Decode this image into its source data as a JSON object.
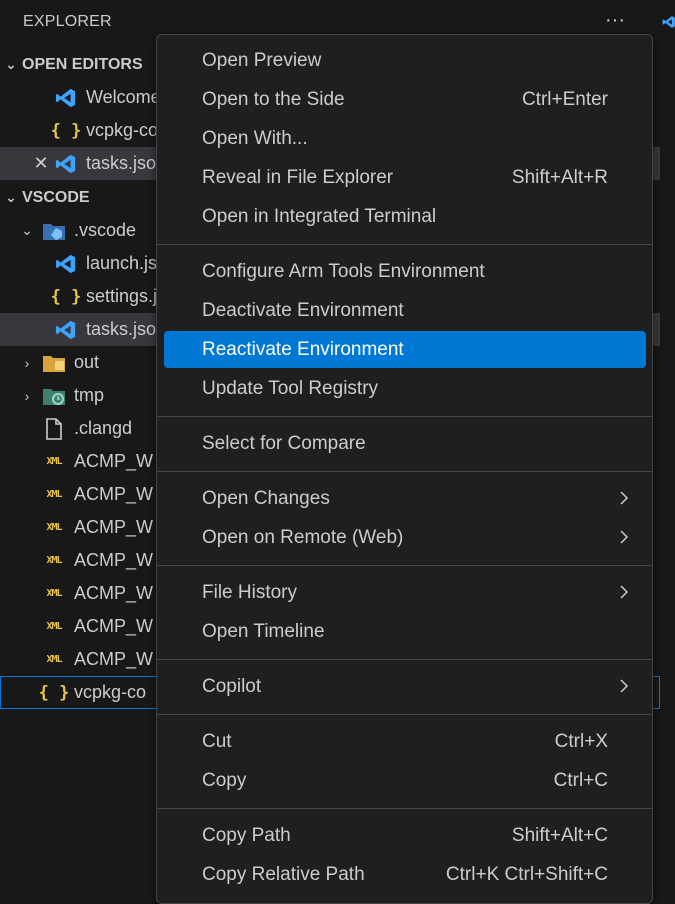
{
  "explorer": {
    "title": "EXPLORER",
    "more_label": "···"
  },
  "open_editors": {
    "header": "OPEN EDITORS",
    "items": [
      {
        "label": "Welcome",
        "icon": "vscode-icon"
      },
      {
        "label": "vcpkg-configuration.json",
        "icon": "json-icon"
      },
      {
        "label": "tasks.json",
        "icon": "vscode-icon"
      }
    ]
  },
  "workspace": {
    "header": "VSCODE",
    "items": [
      {
        "label": ".vscode",
        "icon": "vscode-folder-icon"
      },
      {
        "label": "launch.json",
        "icon": "vscode-icon"
      },
      {
        "label": "settings.json",
        "icon": "json-icon"
      },
      {
        "label": "tasks.json",
        "icon": "vscode-icon"
      },
      {
        "label": "out",
        "icon": "out-folder-icon"
      },
      {
        "label": "tmp",
        "icon": "tmp-folder-icon"
      },
      {
        "label": ".clangd",
        "icon": "file-icon"
      },
      {
        "label": "ACMP_W",
        "icon": "xml-icon"
      },
      {
        "label": "ACMP_W",
        "icon": "xml-icon"
      },
      {
        "label": "ACMP_W",
        "icon": "xml-icon"
      },
      {
        "label": "ACMP_W",
        "icon": "xml-icon"
      },
      {
        "label": "ACMP_W",
        "icon": "xml-icon"
      },
      {
        "label": "ACMP_W",
        "icon": "xml-icon"
      },
      {
        "label": "vcpkg-co",
        "icon": "json-icon"
      }
    ]
  },
  "icons": {
    "json_glyph": "{ }",
    "xml_glyph": "XML",
    "close_glyph": "✕"
  },
  "context_menu": {
    "items": [
      {
        "label": "Open Preview",
        "shortcut": ""
      },
      {
        "label": "Open to the Side",
        "shortcut": "Ctrl+Enter"
      },
      {
        "label": "Open With...",
        "shortcut": ""
      },
      {
        "label": "Reveal in File Explorer",
        "shortcut": "Shift+Alt+R"
      },
      {
        "label": "Open in Integrated Terminal",
        "shortcut": ""
      },
      {
        "label": "Configure Arm Tools Environment",
        "shortcut": ""
      },
      {
        "label": "Deactivate Environment",
        "shortcut": ""
      },
      {
        "label": "Reactivate Environment",
        "shortcut": ""
      },
      {
        "label": "Update Tool Registry",
        "shortcut": ""
      },
      {
        "label": "Select for Compare",
        "shortcut": ""
      },
      {
        "label": "Open Changes",
        "shortcut": ""
      },
      {
        "label": "Open on Remote (Web)",
        "shortcut": ""
      },
      {
        "label": "File History",
        "shortcut": ""
      },
      {
        "label": "Open Timeline",
        "shortcut": ""
      },
      {
        "label": "Copilot",
        "shortcut": ""
      },
      {
        "label": "Cut",
        "shortcut": "Ctrl+X"
      },
      {
        "label": "Copy",
        "shortcut": "Ctrl+C"
      },
      {
        "label": "Copy Path",
        "shortcut": "Shift+Alt+C"
      },
      {
        "label": "Copy Relative Path",
        "shortcut": "Ctrl+K Ctrl+Shift+C"
      }
    ],
    "highlighted": "Reactivate Environment"
  },
  "colors": {
    "background": "#181818",
    "menu_background": "#1f1f1f",
    "accent": "#0078d4",
    "selected_row": "#37373d",
    "json_icon": "#e8c44a",
    "vscode_icon": "#3ea2ff"
  }
}
